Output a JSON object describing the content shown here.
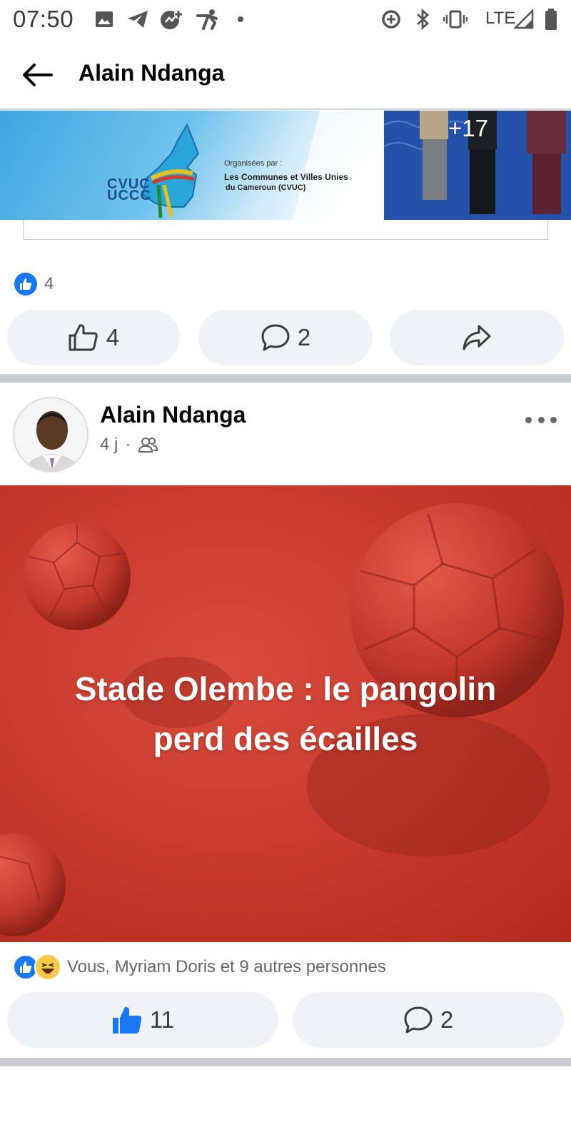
{
  "status_bar": {
    "time": "07:50",
    "network": "LTE",
    "icons": [
      "image-icon",
      "telegram-icon",
      "messenger-icon",
      "runner-icon",
      "dot-icon",
      "data-saver-icon",
      "bluetooth-icon",
      "vibrate-icon",
      "signal-icon",
      "battery-icon"
    ]
  },
  "header": {
    "back_icon": "arrow-left-icon",
    "title": "Alain Ndanga"
  },
  "post1": {
    "banner": {
      "logo_text_top": "CVUC",
      "logo_text_bottom": "UCCC",
      "organised_by": "Organisées par :",
      "org_line1": "Les Communes et Villes Unies",
      "org_line2": "du Cameroun (CVUC)"
    },
    "more_photos": "+17",
    "reaction_count": "4",
    "like_count": "4",
    "comment_count": "2"
  },
  "post2": {
    "author": "Alain Ndanga",
    "time": "4 j",
    "separator": "·",
    "audience_icon": "friends-icon",
    "image_caption_line1": "Stade Olembe : le pangolin",
    "image_caption_line2": "perd des écailles",
    "reactions_text": "Vous, Myriam Doris et 9 autres personnes",
    "like_count": "11",
    "comment_count": "2"
  },
  "colors": {
    "accent": "#1877f2",
    "button_bg": "#f0f2f5",
    "divider": "#c9ccd1",
    "image_bg": "#c73a2c"
  }
}
